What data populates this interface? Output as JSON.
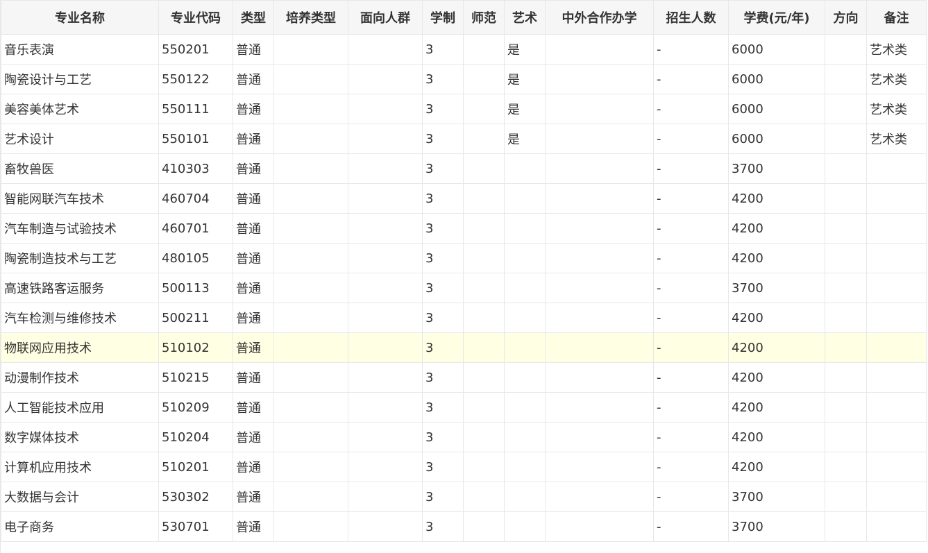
{
  "table": {
    "columns": [
      "专业名称",
      "专业代码",
      "类型",
      "培养类型",
      "面向人群",
      "学制",
      "师范",
      "艺术",
      "中外合作办学",
      "招生人数",
      "学费(元/年)",
      "方向",
      "备注"
    ],
    "rows": [
      [
        "音乐表演",
        "550201",
        "普通",
        "",
        "",
        "3",
        "",
        "是",
        "",
        "-",
        "6000",
        "",
        "艺术类"
      ],
      [
        "陶瓷设计与工艺",
        "550122",
        "普通",
        "",
        "",
        "3",
        "",
        "是",
        "",
        "-",
        "6000",
        "",
        "艺术类"
      ],
      [
        "美容美体艺术",
        "550111",
        "普通",
        "",
        "",
        "3",
        "",
        "是",
        "",
        "-",
        "6000",
        "",
        "艺术类"
      ],
      [
        "艺术设计",
        "550101",
        "普通",
        "",
        "",
        "3",
        "",
        "是",
        "",
        "-",
        "6000",
        "",
        "艺术类"
      ],
      [
        "畜牧兽医",
        "410303",
        "普通",
        "",
        "",
        "3",
        "",
        "",
        "",
        "-",
        "3700",
        "",
        ""
      ],
      [
        "智能网联汽车技术",
        "460704",
        "普通",
        "",
        "",
        "3",
        "",
        "",
        "",
        "-",
        "4200",
        "",
        ""
      ],
      [
        "汽车制造与试验技术",
        "460701",
        "普通",
        "",
        "",
        "3",
        "",
        "",
        "",
        "-",
        "4200",
        "",
        ""
      ],
      [
        "陶瓷制造技术与工艺",
        "480105",
        "普通",
        "",
        "",
        "3",
        "",
        "",
        "",
        "-",
        "4200",
        "",
        ""
      ],
      [
        "高速铁路客运服务",
        "500113",
        "普通",
        "",
        "",
        "3",
        "",
        "",
        "",
        "-",
        "3700",
        "",
        ""
      ],
      [
        "汽车检测与维修技术",
        "500211",
        "普通",
        "",
        "",
        "3",
        "",
        "",
        "",
        "-",
        "4200",
        "",
        ""
      ],
      [
        "物联网应用技术",
        "510102",
        "普通",
        "",
        "",
        "3",
        "",
        "",
        "",
        "-",
        "4200",
        "",
        ""
      ],
      [
        "动漫制作技术",
        "510215",
        "普通",
        "",
        "",
        "3",
        "",
        "",
        "",
        "-",
        "4200",
        "",
        ""
      ],
      [
        "人工智能技术应用",
        "510209",
        "普通",
        "",
        "",
        "3",
        "",
        "",
        "",
        "-",
        "4200",
        "",
        ""
      ],
      [
        "数字媒体技术",
        "510204",
        "普通",
        "",
        "",
        "3",
        "",
        "",
        "",
        "-",
        "4200",
        "",
        ""
      ],
      [
        "计算机应用技术",
        "510201",
        "普通",
        "",
        "",
        "3",
        "",
        "",
        "",
        "-",
        "4200",
        "",
        ""
      ],
      [
        "大数据与会计",
        "530302",
        "普通",
        "",
        "",
        "3",
        "",
        "",
        "",
        "-",
        "3700",
        "",
        ""
      ],
      [
        "电子商务",
        "530701",
        "普通",
        "",
        "",
        "3",
        "",
        "",
        "",
        "-",
        "3700",
        "",
        ""
      ]
    ],
    "highlight_row_color": "#ffffe3",
    "header_background": "#f6f6f6",
    "border_color": "#e8e8e8"
  }
}
